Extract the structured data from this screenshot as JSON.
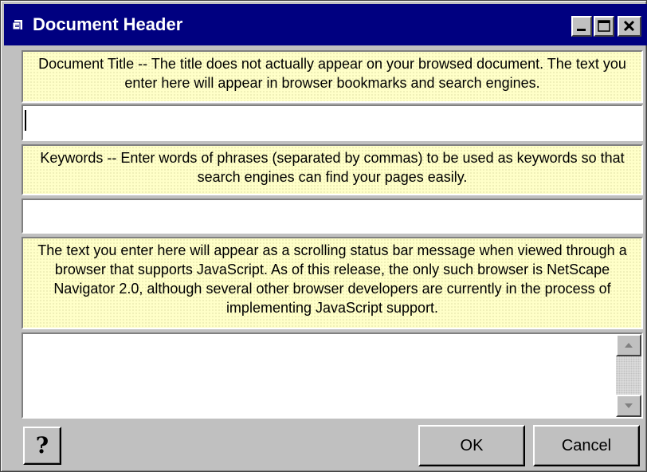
{
  "window": {
    "title": "Document Header",
    "icon": "document-app-icon",
    "controls": [
      "minimize-icon",
      "maximize-icon",
      "close-icon"
    ]
  },
  "sections": {
    "title_help": "Document Title -- The title does not actually appear on your browsed document. The text you enter here will appear in browser bookmarks and search engines.",
    "title_value": "",
    "keywords_help": "Keywords -- Enter words of phrases (separated by commas) to be used as keywords so that search engines can find your pages easily.",
    "keywords_value": "",
    "status_help": "The text you enter here will appear as a scrolling status bar message when viewed through a browser that supports JavaScript.  As of this release, the only such browser is NetScape Navigator 2.0, although several other browser developers are currently in the process of implementing JavaScript support.",
    "status_value": ""
  },
  "buttons": {
    "help_label": "?",
    "ok_label": "OK",
    "cancel_label": "Cancel"
  },
  "colors": {
    "titlebar": "#000080",
    "panel_background": "#ffffc8",
    "face": "#c0c0c0"
  }
}
